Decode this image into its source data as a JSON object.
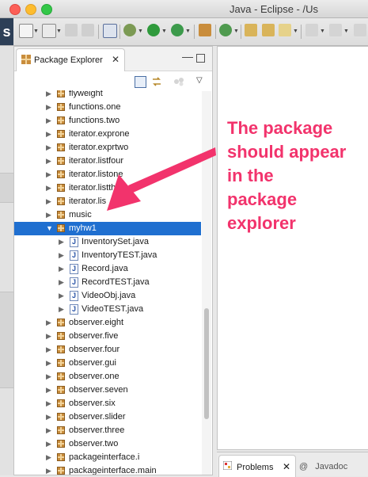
{
  "window": {
    "title": "Java - Eclipse - /Us"
  },
  "brand_letter": "s",
  "package_explorer": {
    "tab_label": "Package Explorer",
    "close_glyph": "✕",
    "minimize_glyph": "—"
  },
  "tree": [
    {
      "label": "flyweight",
      "type": "package",
      "indent": 0,
      "expanded": false,
      "selected": false
    },
    {
      "label": "functions.one",
      "type": "package",
      "indent": 0,
      "expanded": false,
      "selected": false
    },
    {
      "label": "functions.two",
      "type": "package",
      "indent": 0,
      "expanded": false,
      "selected": false
    },
    {
      "label": "iterator.exprone",
      "type": "package",
      "indent": 0,
      "expanded": false,
      "selected": false
    },
    {
      "label": "iterator.exprtwo",
      "type": "package",
      "indent": 0,
      "expanded": false,
      "selected": false
    },
    {
      "label": "iterator.listfour",
      "type": "package",
      "indent": 0,
      "expanded": false,
      "selected": false
    },
    {
      "label": "iterator.listone",
      "type": "package",
      "indent": 0,
      "expanded": false,
      "selected": false
    },
    {
      "label": "iterator.listthree",
      "type": "package",
      "indent": 0,
      "expanded": false,
      "selected": false
    },
    {
      "label": "iterator.lis",
      "type": "package",
      "indent": 0,
      "expanded": false,
      "selected": false
    },
    {
      "label": "music",
      "type": "package",
      "indent": 0,
      "expanded": false,
      "selected": false
    },
    {
      "label": "myhw1",
      "type": "package",
      "indent": 0,
      "expanded": true,
      "selected": true
    },
    {
      "label": "InventorySet.java",
      "type": "java",
      "indent": 1,
      "expanded": false,
      "selected": false
    },
    {
      "label": "InventoryTEST.java",
      "type": "java",
      "indent": 1,
      "expanded": false,
      "selected": false
    },
    {
      "label": "Record.java",
      "type": "java",
      "indent": 1,
      "expanded": false,
      "selected": false
    },
    {
      "label": "RecordTEST.java",
      "type": "java",
      "indent": 1,
      "expanded": false,
      "selected": false
    },
    {
      "label": "VideoObj.java",
      "type": "java",
      "indent": 1,
      "expanded": false,
      "selected": false
    },
    {
      "label": "VideoTEST.java",
      "type": "java",
      "indent": 1,
      "expanded": false,
      "selected": false
    },
    {
      "label": "observer.eight",
      "type": "package",
      "indent": 0,
      "expanded": false,
      "selected": false
    },
    {
      "label": "observer.five",
      "type": "package",
      "indent": 0,
      "expanded": false,
      "selected": false
    },
    {
      "label": "observer.four",
      "type": "package",
      "indent": 0,
      "expanded": false,
      "selected": false
    },
    {
      "label": "observer.gui",
      "type": "package",
      "indent": 0,
      "expanded": false,
      "selected": false
    },
    {
      "label": "observer.one",
      "type": "package",
      "indent": 0,
      "expanded": false,
      "selected": false
    },
    {
      "label": "observer.seven",
      "type": "package",
      "indent": 0,
      "expanded": false,
      "selected": false
    },
    {
      "label": "observer.six",
      "type": "package",
      "indent": 0,
      "expanded": false,
      "selected": false
    },
    {
      "label": "observer.slider",
      "type": "package",
      "indent": 0,
      "expanded": false,
      "selected": false
    },
    {
      "label": "observer.three",
      "type": "package",
      "indent": 0,
      "expanded": false,
      "selected": false
    },
    {
      "label": "observer.two",
      "type": "package",
      "indent": 0,
      "expanded": false,
      "selected": false
    },
    {
      "label": "packageinterface.i",
      "type": "package",
      "indent": 0,
      "expanded": false,
      "selected": false
    },
    {
      "label": "packageinterface.main",
      "type": "package",
      "indent": 0,
      "expanded": false,
      "selected": false
    }
  ],
  "bottom_tabs": {
    "problems": "Problems",
    "javadoc": "Javadoc",
    "javadoc_icon": "@"
  },
  "annotation": {
    "lines": [
      "The package",
      "should appear",
      "in the",
      "package",
      "explorer"
    ],
    "color": "#f2336c"
  },
  "colors": {
    "selection": "#1f6fd0",
    "package_icon": "#c98d3c"
  }
}
